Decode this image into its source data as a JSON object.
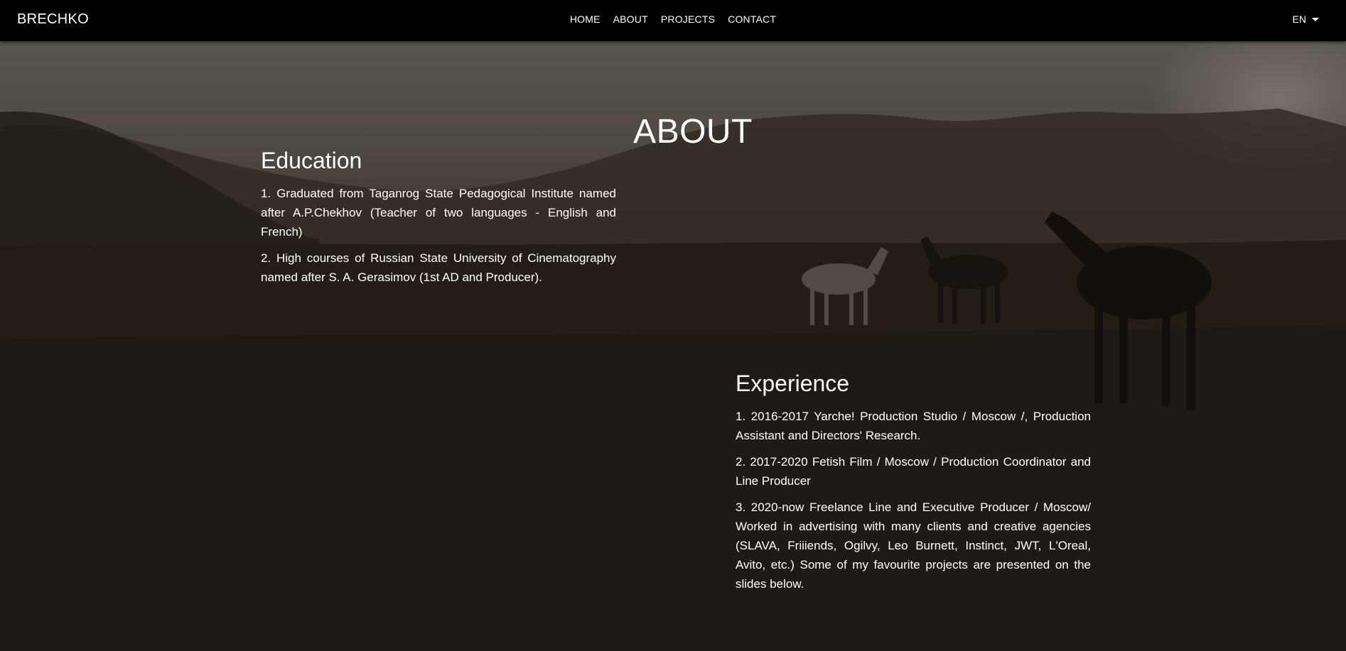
{
  "navbar": {
    "brand": "BRECHKO",
    "links": [
      "HOME",
      "ABOUT",
      "PROJECTS",
      "CONTACT"
    ],
    "language": "EN"
  },
  "page": {
    "title": "ABOUT"
  },
  "education": {
    "heading": "Education",
    "items": [
      "1. Graduated from Taganrog State Pedagogical Institute named after A.P.Chekhov (Teacher of two languages - English and French)",
      "2. High courses of Russian State University of Cinematography named after S. A. Gerasimov (1st AD and Producer)."
    ]
  },
  "experience": {
    "heading": "Experience",
    "items": [
      "1. 2016-2017 Yarche! Production Studio / Moscow /, Production Assistant and Directors' Research.",
      "2. 2017-2020 Fetish Film / Moscow / Production Coordinator and Line Producer",
      "3. 2020-now Freelance Line and Executive Producer / Moscow/ Worked in advertising with many clients and creative agencies (SLAVA, Friiiends, Ogilvy, Leo Burnett, Instinct, JWT, L'Oreal, Avito, etc.) Some of my favourite projects are presented on the slides below."
    ]
  },
  "colors": {
    "navbar_bg": "#000000",
    "text": "#ffffff"
  }
}
